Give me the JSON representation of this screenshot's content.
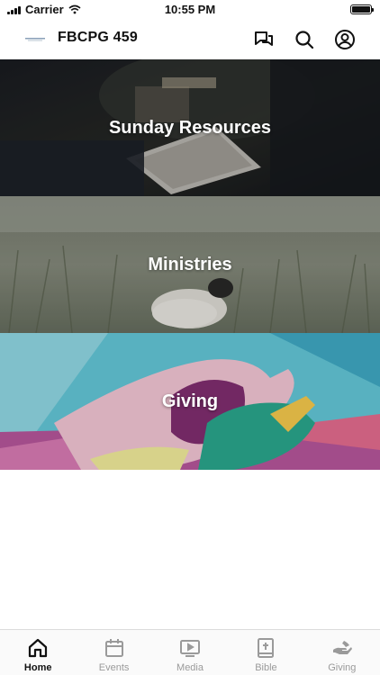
{
  "status_bar": {
    "carrier": "Carrier",
    "time": "10:55 PM"
  },
  "header": {
    "title": "FBCPG 459",
    "icons": [
      "chat-icon",
      "search-icon",
      "profile-icon"
    ]
  },
  "tiles": [
    {
      "label": "Sunday Resources"
    },
    {
      "label": "Ministries"
    },
    {
      "label": "Giving"
    }
  ],
  "tab_bar": {
    "active": "Home",
    "tabs": [
      {
        "label": "Home",
        "icon": "home-icon"
      },
      {
        "label": "Events",
        "icon": "calendar-icon"
      },
      {
        "label": "Media",
        "icon": "media-icon"
      },
      {
        "label": "Bible",
        "icon": "bible-icon"
      },
      {
        "label": "Giving",
        "icon": "giving-hand-icon"
      }
    ]
  },
  "colors": {
    "active_tab": "#111111",
    "inactive_tab": "#9a9a9a",
    "tile_text": "#ffffff"
  }
}
